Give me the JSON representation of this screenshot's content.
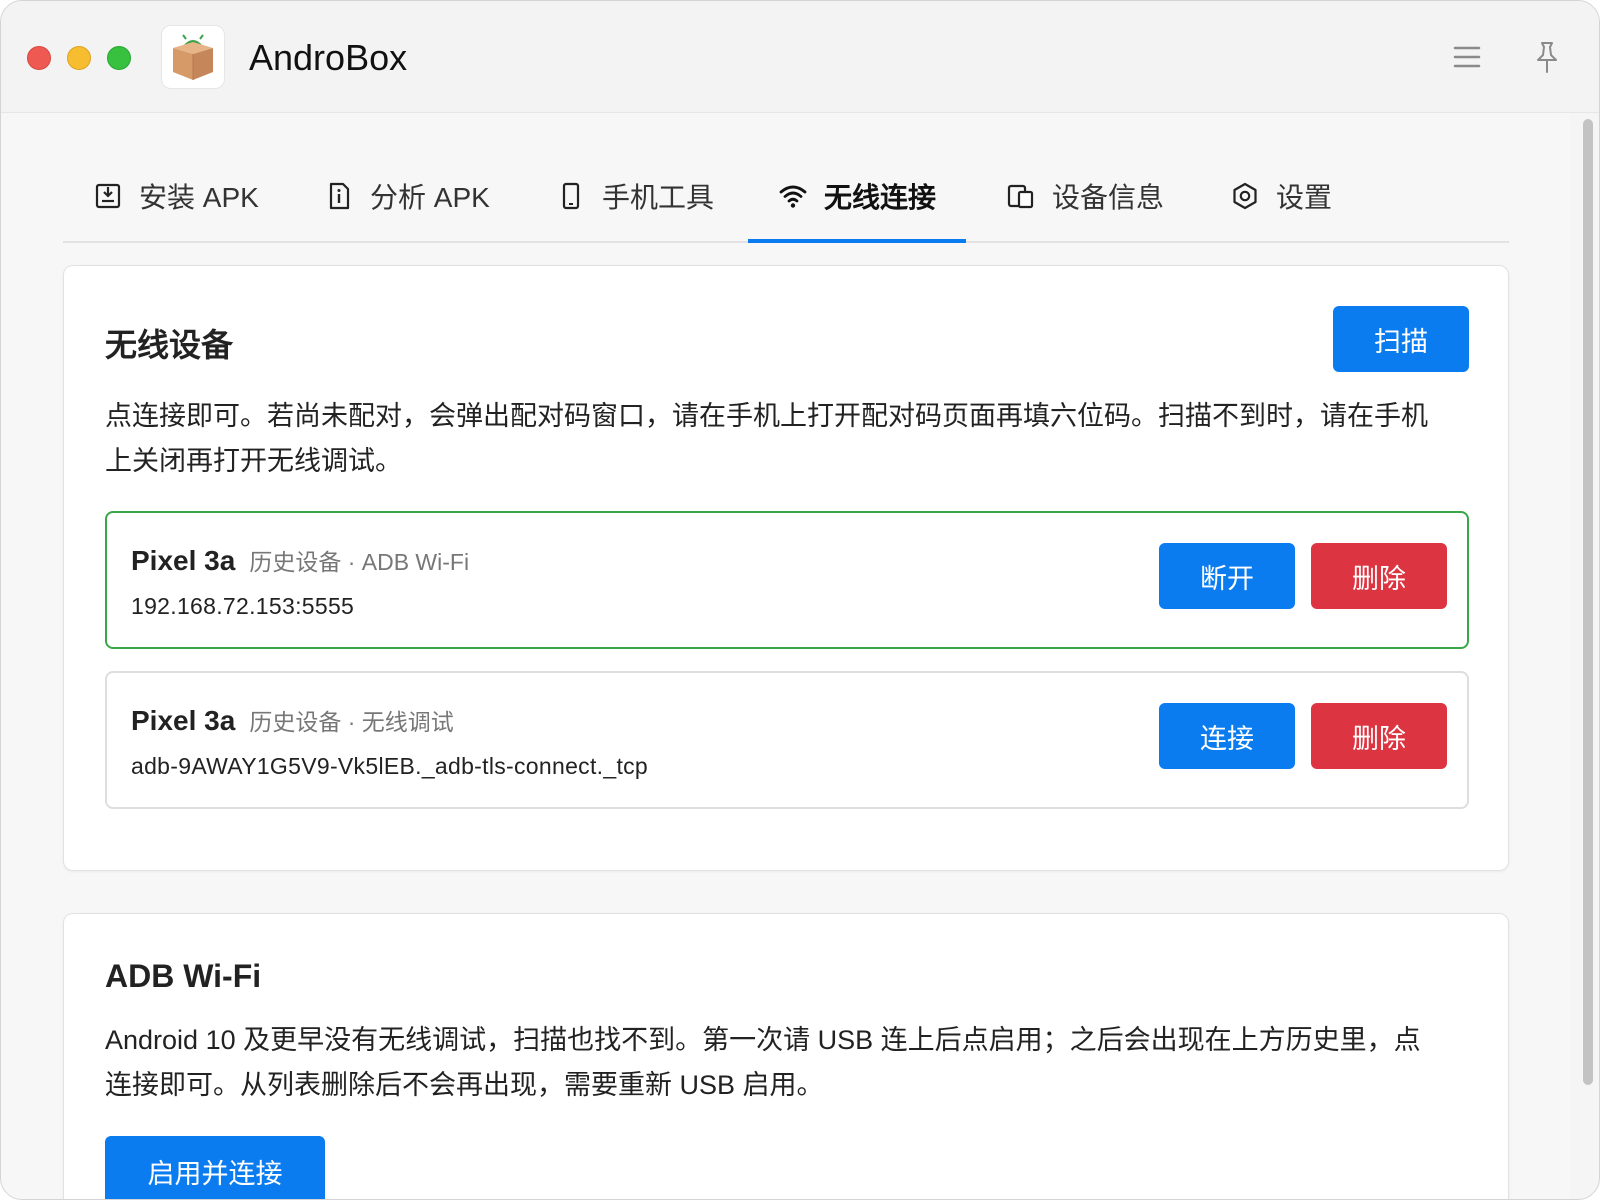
{
  "app": {
    "title": "AndroBox",
    "logo_icon": "android-box-logo-icon",
    "menu_icon": "hamburger-menu-icon",
    "pin_icon": "pin-icon"
  },
  "tabs": [
    {
      "label": "安装 APK",
      "icon": "install-save-icon"
    },
    {
      "label": "分析 APK",
      "icon": "file-info-icon"
    },
    {
      "label": "手机工具",
      "icon": "phone-icon"
    },
    {
      "label": "无线连接",
      "icon": "wifi-icon",
      "active": true
    },
    {
      "label": "设备信息",
      "icon": "devices-icon"
    },
    {
      "label": "设置",
      "icon": "settings-hex-icon"
    }
  ],
  "wireless": {
    "title": "无线设备",
    "scan_label": "扫描",
    "description": "点连接即可。若尚未配对，会弹出配对码窗口，请在手机上打开配对码页面再填六位码。扫描不到时，请在手机上关闭再打开无线调试。",
    "devices": [
      {
        "name": "Pixel 3a",
        "meta": "历史设备 · ADB Wi-Fi",
        "address": "192.168.72.153:5555",
        "primary_label": "断开",
        "delete_label": "删除",
        "connected": true
      },
      {
        "name": "Pixel 3a",
        "meta": "历史设备 · 无线调试",
        "address": "adb-9AWAY1G5V9-Vk5lEB._adb-tls-connect._tcp",
        "primary_label": "连接",
        "delete_label": "删除",
        "connected": false
      }
    ]
  },
  "adb_wifi": {
    "title": "ADB Wi-Fi",
    "description": "Android 10 及更早没有无线调试，扫描也找不到。第一次请 USB 连上后点启用；之后会出现在上方历史里，点连接即可。从列表删除后不会再出现，需要重新 USB 启用。",
    "enable_label": "启用并连接"
  },
  "colors": {
    "accent": "#0b7cf0",
    "danger": "#dc3440",
    "connected_border": "#3aa746"
  }
}
